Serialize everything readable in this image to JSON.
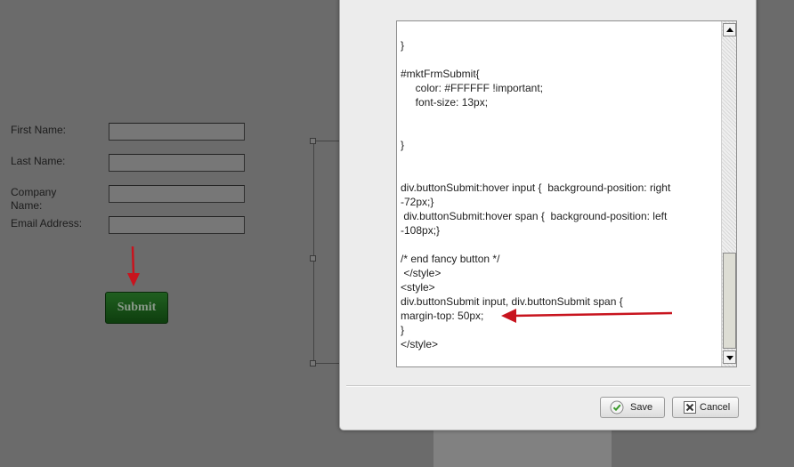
{
  "form": {
    "fields": [
      {
        "label": "First Name:",
        "value": ""
      },
      {
        "label": "Last Name:",
        "value": ""
      },
      {
        "label": "Company Name:",
        "value": ""
      },
      {
        "label": "Email Address:",
        "value": ""
      }
    ],
    "submit_label": "Submit"
  },
  "editor": {
    "lines": [
      "}",
      "",
      "#mktFrmSubmit{",
      "     color: #FFFFFF !important;",
      "     font-size: 13px;",
      "",
      "",
      "}",
      "",
      "",
      "div.buttonSubmit:hover input {  background-position: right",
      "-72px;}",
      " div.buttonSubmit:hover span {  background-position: left",
      "-108px;}",
      "",
      "/* end fancy button */",
      " </style>",
      "<style>",
      "div.buttonSubmit input, div.buttonSubmit span {",
      "margin-top: 50px;",
      "}",
      "</style>"
    ]
  },
  "dialog": {
    "save_label": "Save",
    "cancel_label": "Cancel"
  },
  "icons": {
    "save": "check-circle-icon",
    "cancel": "x-box-icon",
    "annotation": "red-arrow-icon"
  },
  "colors": {
    "overlay": "#6b6b6b",
    "submit_green": "#1c5a1c",
    "annotation_red": "#c8141e"
  }
}
